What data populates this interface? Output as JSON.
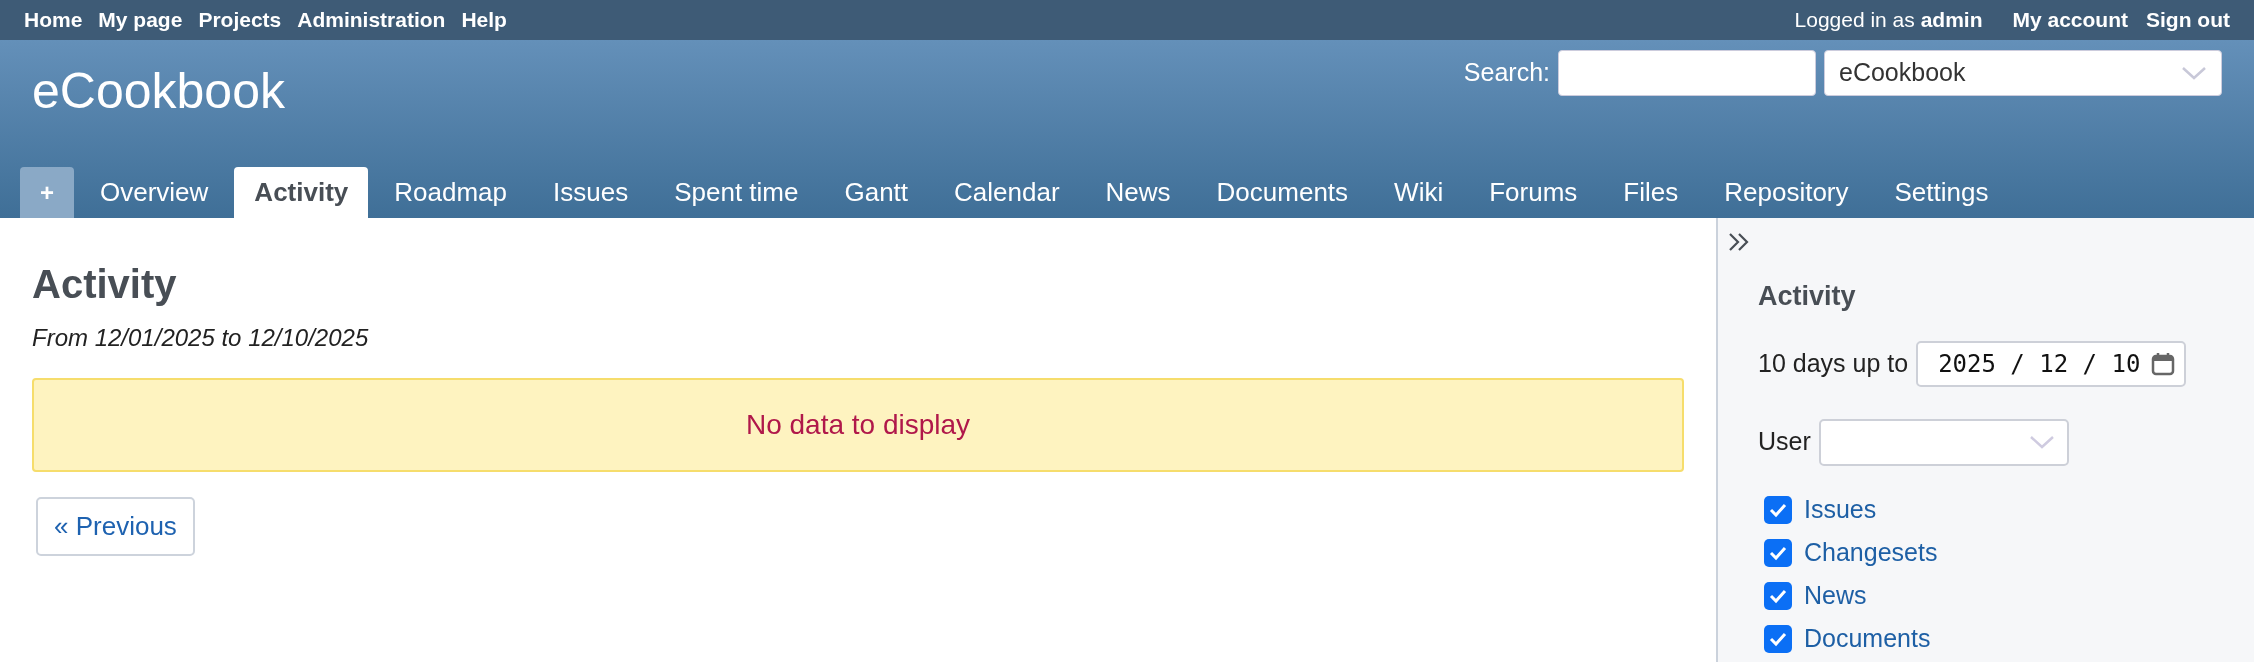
{
  "top_menu": {
    "items": [
      "Home",
      "My page",
      "Projects",
      "Administration",
      "Help"
    ],
    "logged_in": "Logged in as **admin**",
    "account_links": [
      "My account",
      "Sign out"
    ]
  },
  "header": {
    "title": "eCookbook",
    "search_label": "Search:",
    "project_select": "eCookbook"
  },
  "tabs": [
    {
      "label": "+",
      "kind": "new",
      "selected": false
    },
    {
      "label": "Overview",
      "kind": "tab",
      "selected": false
    },
    {
      "label": "Activity",
      "kind": "tab",
      "selected": true
    },
    {
      "label": "Roadmap",
      "kind": "tab",
      "selected": false
    },
    {
      "label": "Issues",
      "kind": "tab",
      "selected": false
    },
    {
      "label": "Spent time",
      "kind": "tab",
      "selected": false
    },
    {
      "label": "Gantt",
      "kind": "tab",
      "selected": false
    },
    {
      "label": "Calendar",
      "kind": "tab",
      "selected": false
    },
    {
      "label": "News",
      "kind": "tab",
      "selected": false
    },
    {
      "label": "Documents",
      "kind": "tab",
      "selected": false
    },
    {
      "label": "Wiki",
      "kind": "tab",
      "selected": false
    },
    {
      "label": "Forums",
      "kind": "tab",
      "selected": false
    },
    {
      "label": "Files",
      "kind": "tab",
      "selected": false
    },
    {
      "label": "Repository",
      "kind": "tab",
      "selected": false
    },
    {
      "label": "Settings",
      "kind": "tab",
      "selected": false
    }
  ],
  "content": {
    "title": "Activity",
    "subtitle": "From 12/01/2025 to 12/10/2025",
    "flash": "No data to display",
    "previous_button": "« Previous"
  },
  "sidebar": {
    "title": "Activity",
    "days_label": "10 days up to",
    "date_value": "2025 / 12 / 10",
    "user_label": "User",
    "filters": [
      {
        "label": "Issues",
        "checked": true
      },
      {
        "label": "Changesets",
        "checked": true
      },
      {
        "label": "News",
        "checked": true
      },
      {
        "label": "Documents",
        "checked": true
      }
    ]
  }
}
